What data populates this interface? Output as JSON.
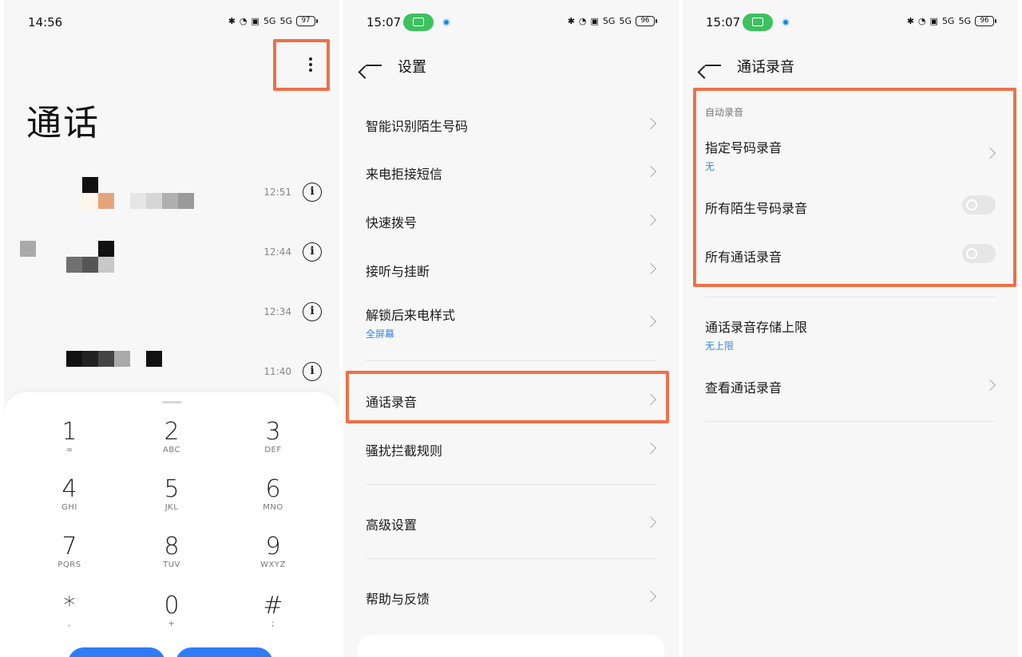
{
  "colors": {
    "accent_blue": "#2f7cf6",
    "highlight_orange": "#ee7146",
    "link_blue": "#3c86e0",
    "status_green": "#3dc15f"
  },
  "screen1": {
    "status": {
      "time": "14:56",
      "battery": "97",
      "net": "5G"
    },
    "title": "通话",
    "calls": [
      {
        "time": "12:51"
      },
      {
        "time": "12:44"
      },
      {
        "time": "12:34"
      },
      {
        "time": "11:40"
      }
    ],
    "keys": [
      {
        "n": "1",
        "l": "∞"
      },
      {
        "n": "2",
        "l": "ABC"
      },
      {
        "n": "3",
        "l": "DEF"
      },
      {
        "n": "4",
        "l": "GHI"
      },
      {
        "n": "5",
        "l": "JKL"
      },
      {
        "n": "6",
        "l": "MNO"
      },
      {
        "n": "7",
        "l": "PQRS"
      },
      {
        "n": "8",
        "l": "TUV"
      },
      {
        "n": "9",
        "l": "WXYZ"
      },
      {
        "n": "*",
        "l": ","
      },
      {
        "n": "0",
        "l": "+"
      },
      {
        "n": "#",
        "l": ";"
      }
    ]
  },
  "screen2": {
    "status": {
      "time": "15:07",
      "battery": "96",
      "net": "5G"
    },
    "title": "设置",
    "items": [
      {
        "label": "智能识别陌生号码"
      },
      {
        "label": "来电拒接短信"
      },
      {
        "label": "快速拨号"
      },
      {
        "label": "接听与挂断"
      },
      {
        "label": "解锁后来电样式",
        "sub": "全屏幕"
      },
      {
        "label": "通话录音"
      },
      {
        "label": "骚扰拦截规则"
      },
      {
        "label": "高级设置"
      },
      {
        "label": "帮助与反馈"
      }
    ]
  },
  "screen3": {
    "status": {
      "time": "15:07",
      "battery": "96",
      "net": "5G"
    },
    "title": "通话录音",
    "section": "自动录音",
    "items": [
      {
        "label": "指定号码录音",
        "sub": "无"
      },
      {
        "label": "所有陌生号码录音"
      },
      {
        "label": "所有通话录音"
      },
      {
        "label": "通话录音存储上限",
        "sub": "无上限"
      },
      {
        "label": "查看通话录音"
      }
    ]
  }
}
